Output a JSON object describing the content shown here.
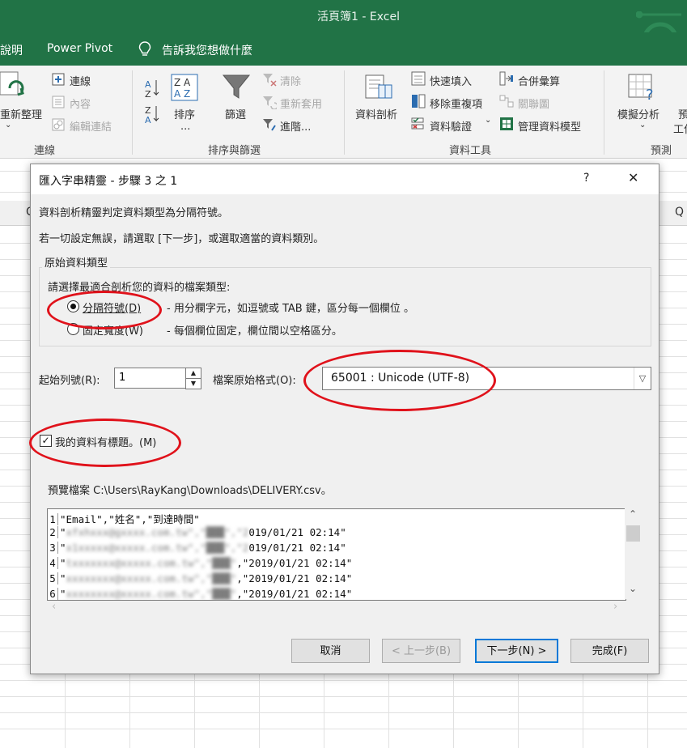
{
  "window": {
    "title": "活頁簿1  -  Excel"
  },
  "tabs": [
    "說明",
    "Power Pivot",
    "告訴我您想做什麼"
  ],
  "ribbon": {
    "connections": {
      "refresh_all": "重新整理",
      "connections": "連線",
      "properties": "內容",
      "edit_links": "編輯連結",
      "group": "連線"
    },
    "sort_filter": {
      "sort": "排序",
      "sort_more": "...",
      "filter": "篩選",
      "clear": "清除",
      "reapply": "重新套用",
      "advanced": "進階...",
      "group": "排序與篩選"
    },
    "data_tools": {
      "text_to_columns": "資料剖析",
      "flash_fill": "快速填入",
      "remove_duplicates": "移除重複項",
      "data_validation": "資料驗證",
      "consolidate": "合併彙算",
      "relationships": "關聯圖",
      "manage_data_model": "管理資料模型",
      "group": "資料工具"
    },
    "forecast": {
      "what_if": "模擬分析",
      "forecast_sheet_partial": "預",
      "forecast_sheet_partial2": "工作",
      "group": "預測"
    }
  },
  "sheet": {
    "col_q": "Q",
    "col_c": "C"
  },
  "dialog": {
    "title": "匯入字串精靈 - 步驟 3 之 1",
    "help": "?",
    "close": "✕",
    "intro1": "資料剖析精靈判定資料類型為分隔符號。",
    "intro2": "若一切設定無誤，請選取 [下一步]，或選取適當的資料類別。",
    "group_label": "原始資料類型",
    "group_prompt": "請選擇最適合剖析您的資料的檔案類型:",
    "delimited_label": "分隔符號(D)",
    "delimited_desc": "- 用分欄字元，如逗號或 TAB 鍵，區分每一個欄位 。",
    "fixed_label": "固定寬度(W)",
    "fixed_desc": "- 每個欄位固定，欄位間以空格區分。",
    "start_row_label": "起始列號(R):",
    "start_row_value": "1",
    "encoding_label": "檔案原始格式(O):",
    "encoding_value": "65001 : Unicode (UTF-8)",
    "header_checkbox": "我的資料有標題。(M)",
    "header_checked": true,
    "preview_label": "預覽檔案 C:\\Users\\RayKang\\Downloads\\DELIVERY.csv。",
    "preview_rows": [
      {
        "n": "1",
        "text": "\"Email\",\"姓名\",\"到達時間\"",
        "blur": "",
        "tail": ""
      },
      {
        "n": "2",
        "text": "\"",
        "blur": "xfxhxxx@gxxxx.com.tw\",\"███\",\"2",
        "tail": "019/01/21 02:14\""
      },
      {
        "n": "3",
        "text": "\"",
        "blur": "x1xxxxx@xxxxx.com.tw\",\"███\",\"2",
        "tail": "019/01/21 02:14\""
      },
      {
        "n": "4",
        "text": "\"",
        "blur": "txxxxxxx@xxxxx.com.tw\",\"███\"",
        "tail": ",\"2019/01/21 02:14\""
      },
      {
        "n": "5",
        "text": "\"",
        "blur": "xxxxxxxx@xxxxx.com.tw\",\"███\"",
        "tail": ",\"2019/01/21 02:14\""
      },
      {
        "n": "6",
        "text": "\"",
        "blur": "xxxxxxxx@xxxxx.com.tw\",\"███\"",
        "tail": ",\"2019/01/21 02:14\""
      }
    ],
    "buttons": {
      "cancel": "取消",
      "back": "< 上一步(B)",
      "next": "下一步(N) >",
      "finish": "完成(F)"
    }
  }
}
